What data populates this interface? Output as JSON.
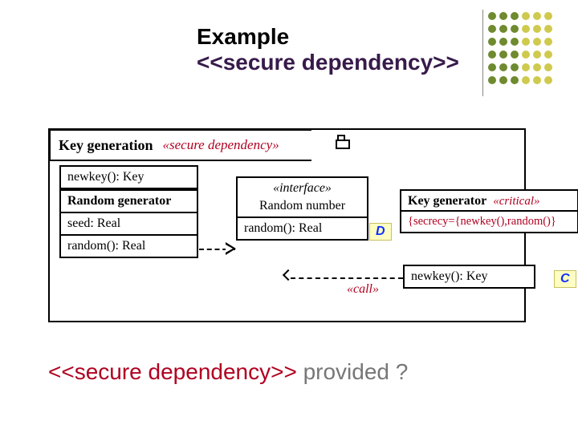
{
  "title": {
    "line1": "Example",
    "line2": "<<secure dependency>>"
  },
  "package": {
    "name": "Key generation",
    "stereotype": "«secure dependency»"
  },
  "classes": {
    "stray_op": "newkey(): Key",
    "random_generator": {
      "name": "Random generator",
      "attr": "seed: Real",
      "op": "random(): Real"
    },
    "iface": {
      "stereotype": "«interface»",
      "name": "Random number",
      "op": "random(): Real"
    },
    "key_generator": {
      "name": "Key generator",
      "stereotype": "«critical»",
      "tag": "{secrecy={newkey(),random()}",
      "op": "newkey(): Key"
    }
  },
  "call_label": "«call»",
  "badge_D": "D",
  "badge_C": "C",
  "bottom": {
    "left": "<<secure dependency>>",
    "right": " provided ?"
  }
}
